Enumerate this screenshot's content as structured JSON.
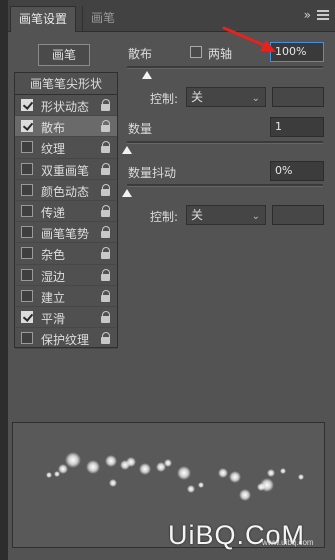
{
  "tabs": [
    {
      "label": "画笔设置"
    },
    {
      "label": "画笔"
    }
  ],
  "tab_menu_glyph": "»",
  "brush_button_label": "画笔",
  "brush_tip_shape_label": "画笔笔尖形状",
  "options": [
    {
      "label": "形状动态",
      "checked": true
    },
    {
      "label": "散布",
      "checked": true
    },
    {
      "label": "纹理",
      "checked": false
    },
    {
      "label": "双重画笔",
      "checked": false
    },
    {
      "label": "颜色动态",
      "checked": false
    },
    {
      "label": "传递",
      "checked": false
    },
    {
      "label": "画笔笔势",
      "checked": false
    },
    {
      "label": "杂色",
      "checked": false
    },
    {
      "label": "湿边",
      "checked": false
    },
    {
      "label": "建立",
      "checked": false
    },
    {
      "label": "平滑",
      "checked": true
    },
    {
      "label": "保护纹理",
      "checked": false
    }
  ],
  "scatter": {
    "label": "散布",
    "both_axes_label": "两轴",
    "both_axes_checked": false,
    "value": "100%",
    "slider_fraction": 0.1
  },
  "control1": {
    "label": "控制:",
    "value": "关"
  },
  "count": {
    "label": "数量",
    "value": "1",
    "slider_fraction": 0.0
  },
  "count_jitter": {
    "label": "数量抖动",
    "value": "0%",
    "slider_fraction": 0.0
  },
  "control2": {
    "label": "控制:",
    "value": "关"
  },
  "watermark": {
    "text": "UiBQ.CoM",
    "sub": "www.uibq.com"
  },
  "colors": {
    "accent_focus": "#4a8ee0",
    "annotation_arrow": "#e8211c"
  }
}
